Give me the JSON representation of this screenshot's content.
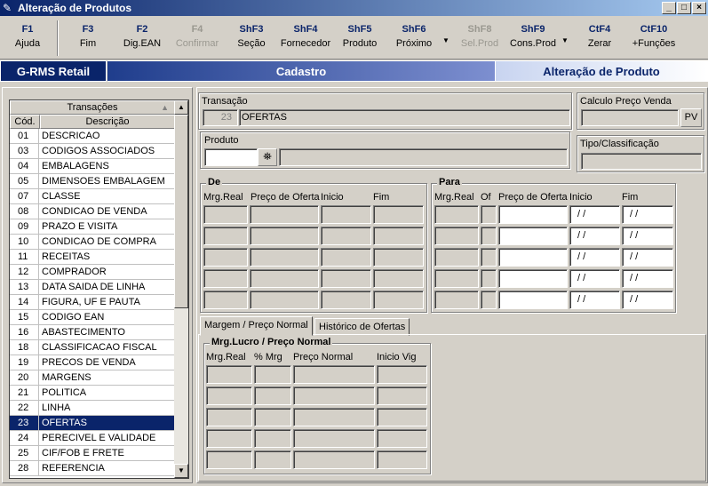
{
  "window": {
    "title": "Alteração de Produtos",
    "controls": [
      "_",
      "□",
      "×"
    ]
  },
  "toolbar": [
    {
      "key": "F1",
      "label": "Ajuda",
      "enabled": true
    },
    {
      "key": "F3",
      "label": "Fim",
      "enabled": true
    },
    {
      "key": "F2",
      "label": "Dig.EAN",
      "enabled": true
    },
    {
      "key": "F4",
      "label": "Confirmar",
      "enabled": false
    },
    {
      "key": "ShF3",
      "label": "Seção",
      "enabled": true
    },
    {
      "key": "ShF4",
      "label": "Fornecedor",
      "enabled": true
    },
    {
      "key": "ShF5",
      "label": "Produto",
      "enabled": true
    },
    {
      "key": "ShF6",
      "label": "Próximo",
      "enabled": true
    },
    {
      "key": "ShF8",
      "label": "Sel.Prod",
      "enabled": false
    },
    {
      "key": "ShF9",
      "label": "Cons.Prod",
      "enabled": true
    },
    {
      "key": "CtF4",
      "label": "Zerar",
      "enabled": true
    },
    {
      "key": "CtF10",
      "label": "+Funções",
      "enabled": true
    }
  ],
  "banner": {
    "brand": "G-RMS Retail",
    "section": "Cadastro",
    "screen": "Alteração de Produto"
  },
  "transactions": {
    "header": "Transações",
    "col_code": "Cód.",
    "col_desc": "Descrição",
    "selected_code": "23",
    "rows": [
      {
        "code": "01",
        "desc": "DESCRICAO"
      },
      {
        "code": "03",
        "desc": "CODIGOS ASSOCIADOS"
      },
      {
        "code": "04",
        "desc": "EMBALAGENS"
      },
      {
        "code": "05",
        "desc": "DIMENSOES EMBALAGEM"
      },
      {
        "code": "07",
        "desc": "CLASSE"
      },
      {
        "code": "08",
        "desc": "CONDICAO DE VENDA"
      },
      {
        "code": "09",
        "desc": "PRAZO E VISITA"
      },
      {
        "code": "10",
        "desc": "CONDICAO DE COMPRA"
      },
      {
        "code": "11",
        "desc": "RECEITAS"
      },
      {
        "code": "12",
        "desc": "COMPRADOR"
      },
      {
        "code": "13",
        "desc": "DATA SAIDA DE LINHA"
      },
      {
        "code": "14",
        "desc": "FIGURA, UF E PAUTA"
      },
      {
        "code": "15",
        "desc": "CODIGO EAN"
      },
      {
        "code": "16",
        "desc": "ABASTECIMENTO"
      },
      {
        "code": "18",
        "desc": "CLASSIFICACAO FISCAL"
      },
      {
        "code": "19",
        "desc": "PRECOS DE VENDA"
      },
      {
        "code": "20",
        "desc": "MARGENS"
      },
      {
        "code": "21",
        "desc": "POLITICA"
      },
      {
        "code": "22",
        "desc": "LINHA"
      },
      {
        "code": "23",
        "desc": "OFERTAS"
      },
      {
        "code": "24",
        "desc": "PERECIVEL E VALIDADE"
      },
      {
        "code": "25",
        "desc": "CIF/FOB E FRETE"
      },
      {
        "code": "28",
        "desc": "REFERENCIA"
      }
    ]
  },
  "transacao": {
    "label": "Transação",
    "code": "23",
    "name": "OFERTAS"
  },
  "produto": {
    "label": "Produto",
    "code_value": "",
    "desc_value": ""
  },
  "calculo": {
    "label": "Calculo Preço Venda",
    "button": "PV"
  },
  "tipo": {
    "label": "Tipo/Classificação"
  },
  "de": {
    "title": "De",
    "cols": [
      "Mrg.Real",
      "Preço de Oferta",
      "Inicio",
      "Fim"
    ]
  },
  "para": {
    "title": "Para",
    "cols": [
      "Mrg.Real",
      "Of",
      "Preço de Oferta",
      "Inicio",
      "Fim"
    ],
    "date_placeholder": " / /"
  },
  "tabs": [
    "Margem / Preço Normal",
    "Histórico de Ofertas"
  ],
  "margem": {
    "title": "Mrg.Lucro / Preço Normal",
    "cols": [
      "Mrg.Real",
      "% Mrg",
      "Preço Normal",
      "Inicio Vig"
    ]
  }
}
